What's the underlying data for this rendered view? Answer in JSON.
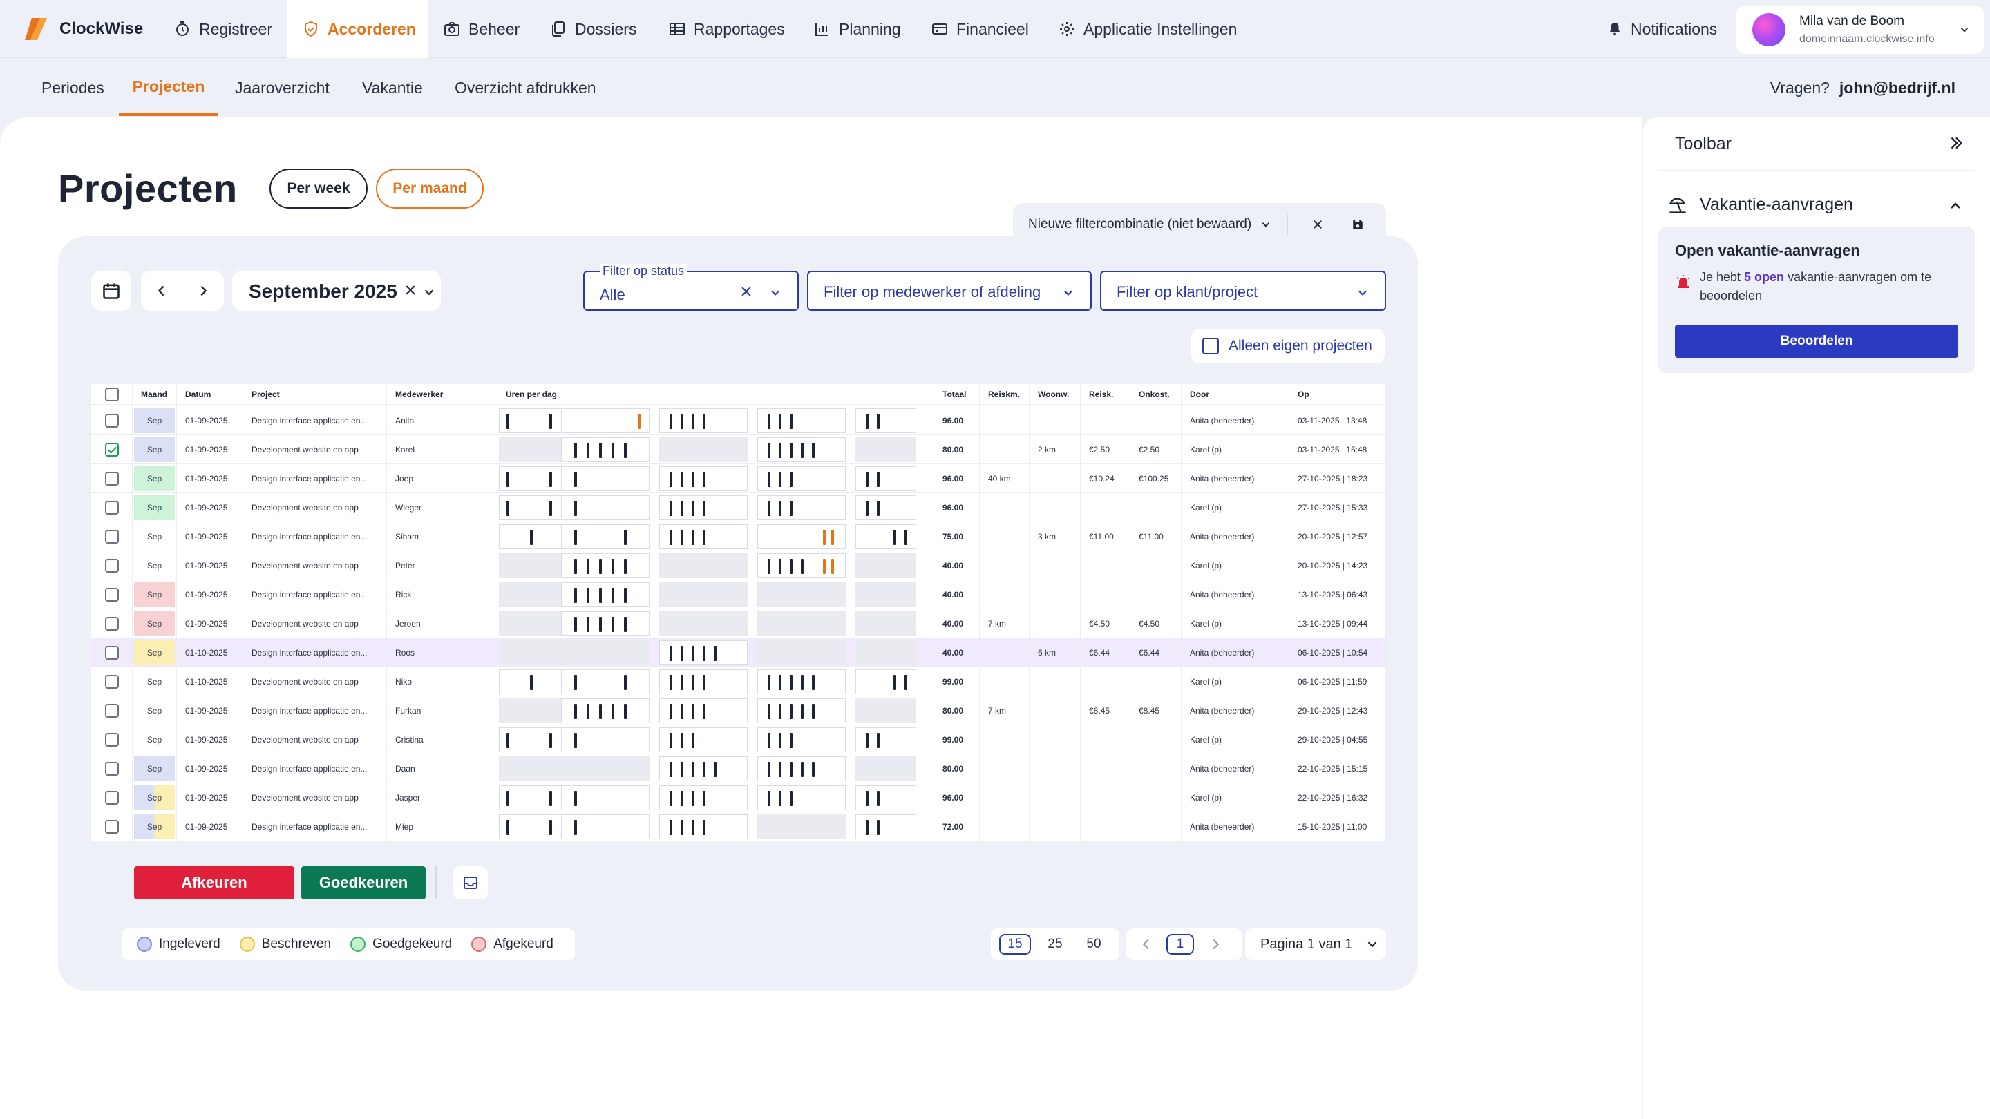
{
  "app": {
    "name": "ClockWise"
  },
  "nav": {
    "items": [
      {
        "label": "Registreer",
        "icon": "stopwatch-icon"
      },
      {
        "label": "Accorderen",
        "icon": "shield-check-icon"
      },
      {
        "label": "Beheer",
        "icon": "camera-icon"
      },
      {
        "label": "Dossiers",
        "icon": "documents-icon"
      },
      {
        "label": "Rapportages",
        "icon": "table-icon"
      },
      {
        "label": "Planning",
        "icon": "bar-chart-icon"
      },
      {
        "label": "Financieel",
        "icon": "credit-card-icon"
      },
      {
        "label": "Applicatie Instellingen",
        "icon": "gear-icon"
      }
    ],
    "notifications_label": "Notifications",
    "user": {
      "name": "Mila van de Boom",
      "domain": "domeinnaam.clockwise.info"
    }
  },
  "subnav": {
    "items": [
      "Periodes",
      "Projecten",
      "Jaaroverzicht",
      "Vakantie",
      "Overzicht afdrukken"
    ],
    "active": "Projecten",
    "questions_label": "Vragen?",
    "questions_email": "john@bedrijf.nl"
  },
  "page": {
    "title": "Projecten",
    "view_week": "Per week",
    "view_month": "Per maand",
    "filter_combination": "Nieuwe filtercombinatie (niet bewaard)",
    "period": "September 2025",
    "filters": {
      "status_label": "Filter op status",
      "status_value": "Alle",
      "employee_placeholder": "Filter op medewerker of afdeling",
      "client_placeholder": "Filter op klant/project"
    },
    "own_projects_label": "Alleen eigen projecten"
  },
  "table": {
    "columns": [
      "Maand",
      "Datum",
      "Project",
      "Medewerker",
      "Uren per dag",
      "Totaal",
      "Reiskm.",
      "Woonw.",
      "Reisk.",
      "Onkost.",
      "Door",
      "Op"
    ],
    "rows": [
      {
        "checked": false,
        "maand": "Sep",
        "status": "ingeleverd",
        "datum": "01-09-2025",
        "project": "Design interface applicatie en...",
        "medewerker": "Anita",
        "totaal": "96.00",
        "reiskm": "",
        "woonw": "",
        "reisk": "",
        "onkost": "",
        "door": "Anita (beheerder)",
        "op": "03-11-2025 | 13:48"
      },
      {
        "checked": true,
        "maand": "Sep",
        "status": "ingeleverd",
        "datum": "01-09-2025",
        "project": "Development website en app",
        "medewerker": "Karel",
        "totaal": "80.00",
        "reiskm": "",
        "woonw": "2 km",
        "reisk": "€2.50",
        "onkost": "€2.50",
        "door": "Karel (p)",
        "op": "03-11-2025 | 15:48"
      },
      {
        "checked": false,
        "maand": "Sep",
        "status": "goedgekeurd",
        "datum": "01-09-2025",
        "project": "Design interface applicatie en...",
        "medewerker": "Joep",
        "totaal": "96.00",
        "reiskm": "40 km",
        "woonw": "",
        "reisk": "€10.24",
        "onkost": "€100.25",
        "door": "Anita (beheerder)",
        "op": "27-10-2025 | 18:23"
      },
      {
        "checked": false,
        "maand": "Sep",
        "status": "goedgekeurd",
        "datum": "01-09-2025",
        "project": "Development website en app",
        "medewerker": "Wieger",
        "totaal": "96.00",
        "reiskm": "",
        "woonw": "",
        "reisk": "",
        "onkost": "",
        "door": "Karel (p)",
        "op": "27-10-2025 | 15:33"
      },
      {
        "checked": false,
        "maand": "Sep",
        "status": "none",
        "datum": "01-09-2025",
        "project": "Design interface applicatie en...",
        "medewerker": "Siham",
        "totaal": "75.00",
        "reiskm": "",
        "woonw": "3 km",
        "reisk": "€11.00",
        "onkost": "€11.00",
        "door": "Anita (beheerder)",
        "op": "20-10-2025 | 12:57"
      },
      {
        "checked": false,
        "maand": "Sep",
        "status": "none",
        "datum": "01-09-2025",
        "project": "Development website en app",
        "medewerker": "Peter",
        "totaal": "40.00",
        "reiskm": "",
        "woonw": "",
        "reisk": "",
        "onkost": "",
        "door": "Karel (p)",
        "op": "20-10-2025 | 14:23"
      },
      {
        "checked": false,
        "maand": "Sep",
        "status": "afgekeurd",
        "datum": "01-09-2025",
        "project": "Design interface applicatie en...",
        "medewerker": "Rick",
        "totaal": "40.00",
        "reiskm": "",
        "woonw": "",
        "reisk": "",
        "onkost": "",
        "door": "Anita (beheerder)",
        "op": "13-10-2025 | 06:43"
      },
      {
        "checked": false,
        "maand": "Sep",
        "status": "afgekeurd",
        "datum": "01-09-2025",
        "project": "Development website en app",
        "medewerker": "Jeroen",
        "totaal": "40.00",
        "reiskm": "7 km",
        "woonw": "",
        "reisk": "€4.50",
        "onkost": "€4.50",
        "door": "Karel (p)",
        "op": "13-10-2025 | 09:44"
      },
      {
        "checked": false,
        "maand": "Sep",
        "status": "beschreven",
        "datum": "01-10-2025",
        "project": "Design interface applicatie en...",
        "medewerker": "Roos",
        "totaal": "40.00",
        "reiskm": "",
        "woonw": "6 km",
        "reisk": "€6.44",
        "onkost": "€6.44",
        "door": "Anita (beheerder)",
        "op": "06-10-2025 | 10:54",
        "highlight": true
      },
      {
        "checked": false,
        "maand": "Sep",
        "status": "none",
        "datum": "01-10-2025",
        "project": "Development website en app",
        "medewerker": "Niko",
        "totaal": "99.00",
        "reiskm": "",
        "woonw": "",
        "reisk": "",
        "onkost": "",
        "door": "Karel (p)",
        "op": "06-10-2025 | 11:59"
      },
      {
        "checked": false,
        "maand": "Sep",
        "status": "none",
        "datum": "01-09-2025",
        "project": "Design interface applicatie en...",
        "medewerker": "Furkan",
        "totaal": "80.00",
        "reiskm": "7 km",
        "woonw": "",
        "reisk": "€8.45",
        "onkost": "€8.45",
        "door": "Anita (beheerder)",
        "op": "29-10-2025 | 12:43"
      },
      {
        "checked": false,
        "maand": "Sep",
        "status": "none",
        "datum": "01-09-2025",
        "project": "Development website en app",
        "medewerker": "Cristina",
        "totaal": "99.00",
        "reiskm": "",
        "woonw": "",
        "reisk": "",
        "onkost": "",
        "door": "Karel (p)",
        "op": "29-10-2025 | 04:55"
      },
      {
        "checked": false,
        "maand": "Sep",
        "status": "ingeleverd",
        "datum": "01-09-2025",
        "project": "Design interface applicatie en...",
        "medewerker": "Daan",
        "totaal": "80.00",
        "reiskm": "",
        "woonw": "",
        "reisk": "",
        "onkost": "",
        "door": "Anita (beheerder)",
        "op": "22-10-2025 | 15:15"
      },
      {
        "checked": false,
        "maand": "Sep",
        "status": "mixed-blue-yellow",
        "datum": "01-09-2025",
        "project": "Development website en app",
        "medewerker": "Jasper",
        "totaal": "96.00",
        "reiskm": "",
        "woonw": "",
        "reisk": "",
        "onkost": "",
        "door": "Karel (p)",
        "op": "22-10-2025 | 16:32"
      },
      {
        "checked": false,
        "maand": "Sep",
        "status": "mixed-blue-yellow",
        "datum": "01-09-2025",
        "project": "Design interface applicatie en...",
        "medewerker": "Miep",
        "totaal": "72.00",
        "reiskm": "",
        "woonw": "",
        "reisk": "",
        "onkost": "",
        "door": "Anita (beheerder)",
        "op": "15-10-2025 | 11:00"
      }
    ]
  },
  "actions": {
    "reject": "Afkeuren",
    "approve": "Goedkeuren"
  },
  "legend": [
    {
      "label": "Ingeleverd",
      "color": "#c9d2f5",
      "border": "#7f8fd8"
    },
    {
      "label": "Beschreven",
      "color": "#fbeeb0",
      "border": "#e7c44a"
    },
    {
      "label": "Goedgekeurd",
      "color": "#c4f0cf",
      "border": "#3bb55f"
    },
    {
      "label": "Afgekeurd",
      "color": "#f6cbcb",
      "border": "#e06868"
    }
  ],
  "pagination": {
    "sizes": [
      "15",
      "25",
      "50"
    ],
    "active_size": "15",
    "current_page": "1",
    "page_of": "Pagina 1 van 1"
  },
  "toolbar": {
    "title": "Toolbar",
    "section_title": "Vakantie-aanvragen",
    "box_title": "Open vakantie-aanvragen",
    "text_before": "Je hebt ",
    "open_count": "5 open",
    "text_after": " vakantie-aanvragen om te beoordelen",
    "button": "Beoordelen"
  },
  "colors": {
    "accent": "#e8731a",
    "primary": "#2b3aa6",
    "approve": "#0b7a54",
    "reject": "#e0203a"
  }
}
